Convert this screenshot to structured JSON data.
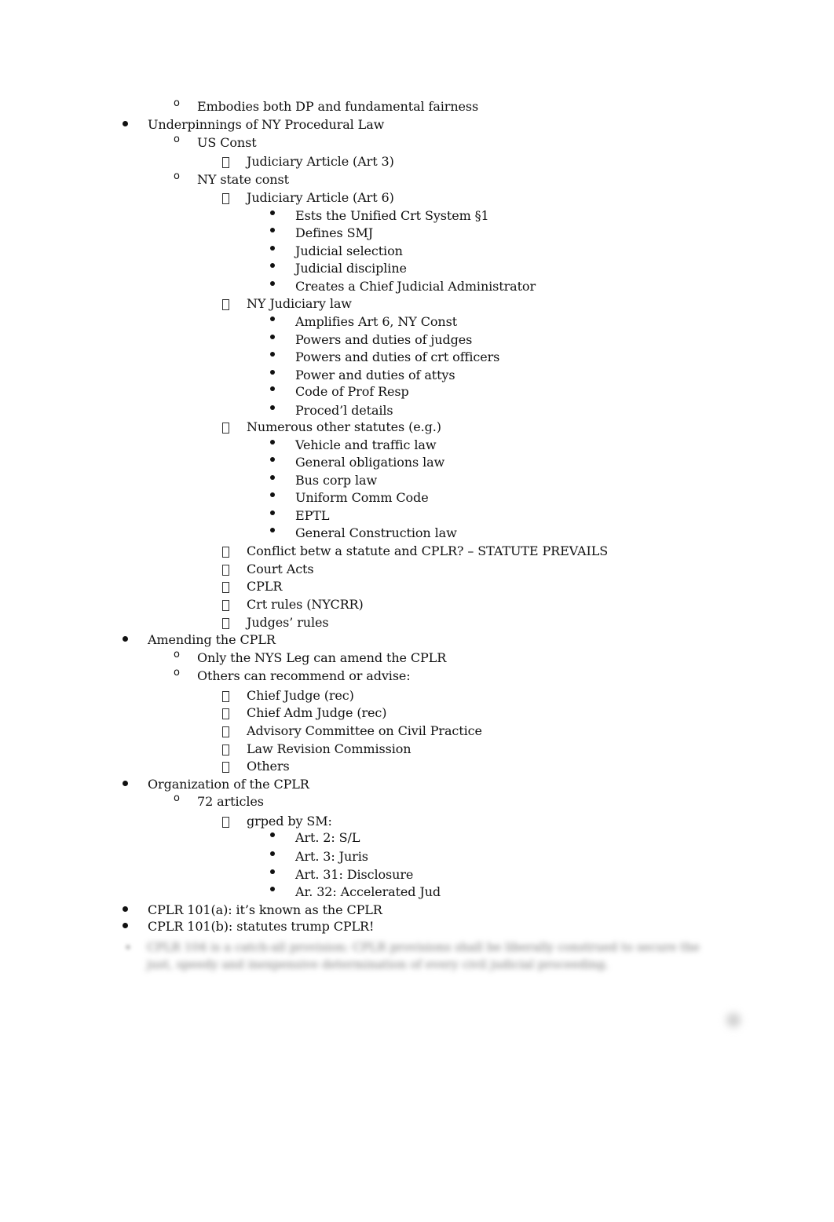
{
  "document": {
    "lines": [
      {
        "level": 2,
        "marker": "circle",
        "text": "Embodies both DP and fundamental fairness"
      },
      {
        "level": 1,
        "marker": "disc",
        "text": "Underpinnings of NY Procedural Law"
      },
      {
        "level": 2,
        "marker": "circle",
        "text": "US Const"
      },
      {
        "level": 3,
        "marker": "box",
        "text": "Judiciary Article (Art 3)"
      },
      {
        "level": 2,
        "marker": "circle",
        "text": "NY state const"
      },
      {
        "level": 3,
        "marker": "box",
        "text": "Judiciary Article (Art 6)"
      },
      {
        "level": 4,
        "marker": "disc",
        "text": "Ests the Unified Crt System §1"
      },
      {
        "level": 4,
        "marker": "disc",
        "text": "Defines SMJ"
      },
      {
        "level": 4,
        "marker": "disc",
        "text": "Judicial selection"
      },
      {
        "level": 4,
        "marker": "disc",
        "text": "Judicial discipline"
      },
      {
        "level": 4,
        "marker": "disc",
        "text": "Creates a Chief Judicial Administrator"
      },
      {
        "level": 3,
        "marker": "box",
        "text": "NY Judiciary law"
      },
      {
        "level": 4,
        "marker": "disc",
        "text": "Amplifies Art 6, NY Const"
      },
      {
        "level": 4,
        "marker": "disc",
        "text": "Powers and duties of judges"
      },
      {
        "level": 4,
        "marker": "disc",
        "text": "Powers and duties of crt officers"
      },
      {
        "level": 4,
        "marker": "disc",
        "text": "Power and duties of attys"
      },
      {
        "level": 4,
        "marker": "disc",
        "text": "Code of Prof Resp"
      },
      {
        "level": 4,
        "marker": "disc",
        "text": "Proced’l details"
      },
      {
        "level": 3,
        "marker": "box",
        "text": "Numerous other statutes (e.g.)"
      },
      {
        "level": 4,
        "marker": "disc",
        "text": "Vehicle and traffic law"
      },
      {
        "level": 4,
        "marker": "disc",
        "text": "General obligations law"
      },
      {
        "level": 4,
        "marker": "disc",
        "text": "Bus corp law"
      },
      {
        "level": 4,
        "marker": "disc",
        "text": "Uniform Comm Code"
      },
      {
        "level": 4,
        "marker": "disc",
        "text": "EPTL"
      },
      {
        "level": 4,
        "marker": "disc",
        "text": "General Construction law"
      },
      {
        "level": 3,
        "marker": "box",
        "text": "Conflict betw a statute and CPLR? – STATUTE PREVAILS"
      },
      {
        "level": 3,
        "marker": "box",
        "text": "Court Acts"
      },
      {
        "level": 3,
        "marker": "box",
        "text": "CPLR"
      },
      {
        "level": 3,
        "marker": "box",
        "text": "Crt rules (NYCRR)"
      },
      {
        "level": 3,
        "marker": "box",
        "text": "Judges’ rules"
      },
      {
        "level": 1,
        "marker": "disc",
        "text": "Amending the CPLR"
      },
      {
        "level": 2,
        "marker": "circle",
        "text": "Only the NYS Leg can amend the CPLR"
      },
      {
        "level": 2,
        "marker": "circle",
        "text": "Others can recommend or advise:"
      },
      {
        "level": 3,
        "marker": "box",
        "text": "Chief Judge (rec)"
      },
      {
        "level": 3,
        "marker": "box",
        "text": "Chief Adm Judge (rec)"
      },
      {
        "level": 3,
        "marker": "box",
        "text": "Advisory Committee on Civil Practice"
      },
      {
        "level": 3,
        "marker": "box",
        "text": "Law Revision Commission"
      },
      {
        "level": 3,
        "marker": "box",
        "text": "Others"
      },
      {
        "level": 1,
        "marker": "disc",
        "text": "Organization of the CPLR"
      },
      {
        "level": 2,
        "marker": "circle",
        "text": "72 articles"
      },
      {
        "level": 3,
        "marker": "box",
        "text": "grped by SM:"
      },
      {
        "level": 4,
        "marker": "disc",
        "text": "Art. 2: S/L"
      },
      {
        "level": 4,
        "marker": "disc",
        "text": "Art. 3: Juris"
      },
      {
        "level": 4,
        "marker": "disc",
        "text": "Art. 31: Disclosure"
      },
      {
        "level": 4,
        "marker": "disc",
        "text": "Ar. 32: Accelerated Jud"
      },
      {
        "level": 1,
        "marker": "disc",
        "text": "CPLR 101(a): it’s known as the CPLR"
      },
      {
        "level": 1,
        "marker": "disc",
        "text": "CPLR 101(b): statutes trump CPLR!"
      }
    ],
    "circle_glyph": "o",
    "blurred_text": "CPLR 104 is a catch-all provision: CPLR provisions shall be liberally construed to secure the just, speedy and inexpensive determination of every civil judicial proceeding.",
    "blurred_note": "Blurred preview content (text not legible)"
  }
}
